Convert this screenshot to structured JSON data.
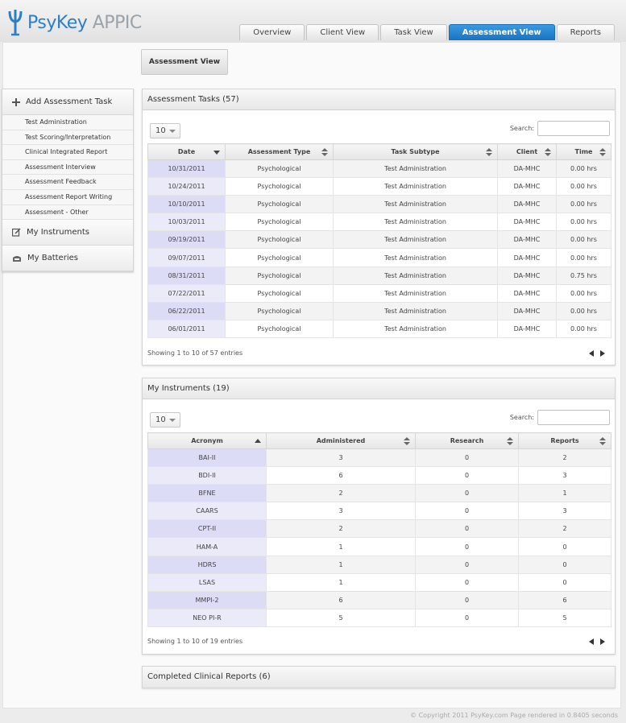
{
  "app": {
    "name_main": "PsyKey",
    "name_sub": "APPIC"
  },
  "tabs": [
    {
      "label": "Overview"
    },
    {
      "label": "Client View"
    },
    {
      "label": "Task View"
    },
    {
      "label": "Assessment View",
      "active": true
    },
    {
      "label": "Reports"
    }
  ],
  "view_button": "Assessment View",
  "sidebar": {
    "add_task": "Add Assessment Task",
    "items": [
      "Test Administration",
      "Test Scoring/Interpretation",
      "Clinical Integrated Report",
      "Assessment Interview",
      "Assessment Feedback",
      "Assessment Report Writing",
      "Assessment - Other"
    ],
    "my_instruments": "My Instruments",
    "my_batteries": "My Batteries"
  },
  "tasks": {
    "title": "Assessment Tasks (57)",
    "length": "10",
    "search_label": "Search:",
    "columns": [
      "Date",
      "Assessment Type",
      "Task Subtype",
      "Client",
      "Time"
    ],
    "rows": [
      [
        "10/31/2011",
        "Psychological",
        "Test Administration",
        "DA-MHC",
        "0.00 hrs"
      ],
      [
        "10/24/2011",
        "Psychological",
        "Test Administration",
        "DA-MHC",
        "0.00 hrs"
      ],
      [
        "10/10/2011",
        "Psychological",
        "Test Administration",
        "DA-MHC",
        "0.00 hrs"
      ],
      [
        "10/03/2011",
        "Psychological",
        "Test Administration",
        "DA-MHC",
        "0.00 hrs"
      ],
      [
        "09/19/2011",
        "Psychological",
        "Test Administration",
        "DA-MHC",
        "0.00 hrs"
      ],
      [
        "09/07/2011",
        "Psychological",
        "Test Administration",
        "DA-MHC",
        "0.00 hrs"
      ],
      [
        "08/31/2011",
        "Psychological",
        "Test Administration",
        "DA-MHC",
        "0.75 hrs"
      ],
      [
        "07/22/2011",
        "Psychological",
        "Test Administration",
        "DA-MHC",
        "0.00 hrs"
      ],
      [
        "06/22/2011",
        "Psychological",
        "Test Administration",
        "DA-MHC",
        "0.00 hrs"
      ],
      [
        "06/01/2011",
        "Psychological",
        "Test Administration",
        "DA-MHC",
        "0.00 hrs"
      ]
    ],
    "info": "Showing 1 to 10 of 57 entries"
  },
  "instruments": {
    "title": "My Instruments (19)",
    "length": "10",
    "search_label": "Search:",
    "columns": [
      "Acronym",
      "Administered",
      "Research",
      "Reports"
    ],
    "rows": [
      [
        "BAI-II",
        "3",
        "0",
        "2"
      ],
      [
        "BDI-II",
        "6",
        "0",
        "3"
      ],
      [
        "BFNE",
        "2",
        "0",
        "1"
      ],
      [
        "CAARS",
        "3",
        "0",
        "3"
      ],
      [
        "CPT-II",
        "2",
        "0",
        "2"
      ],
      [
        "HAM-A",
        "1",
        "0",
        "0"
      ],
      [
        "HDRS",
        "1",
        "0",
        "0"
      ],
      [
        "LSAS",
        "1",
        "0",
        "0"
      ],
      [
        "MMPI-2",
        "6",
        "0",
        "6"
      ],
      [
        "NEO PI-R",
        "5",
        "0",
        "5"
      ]
    ],
    "info": "Showing 1 to 10 of 19 entries"
  },
  "reports": {
    "title": "Completed Clinical Reports (6)"
  },
  "footer": "© Copyright 2011 PsyKey.com Page rendered in 0.8405 seconds"
}
